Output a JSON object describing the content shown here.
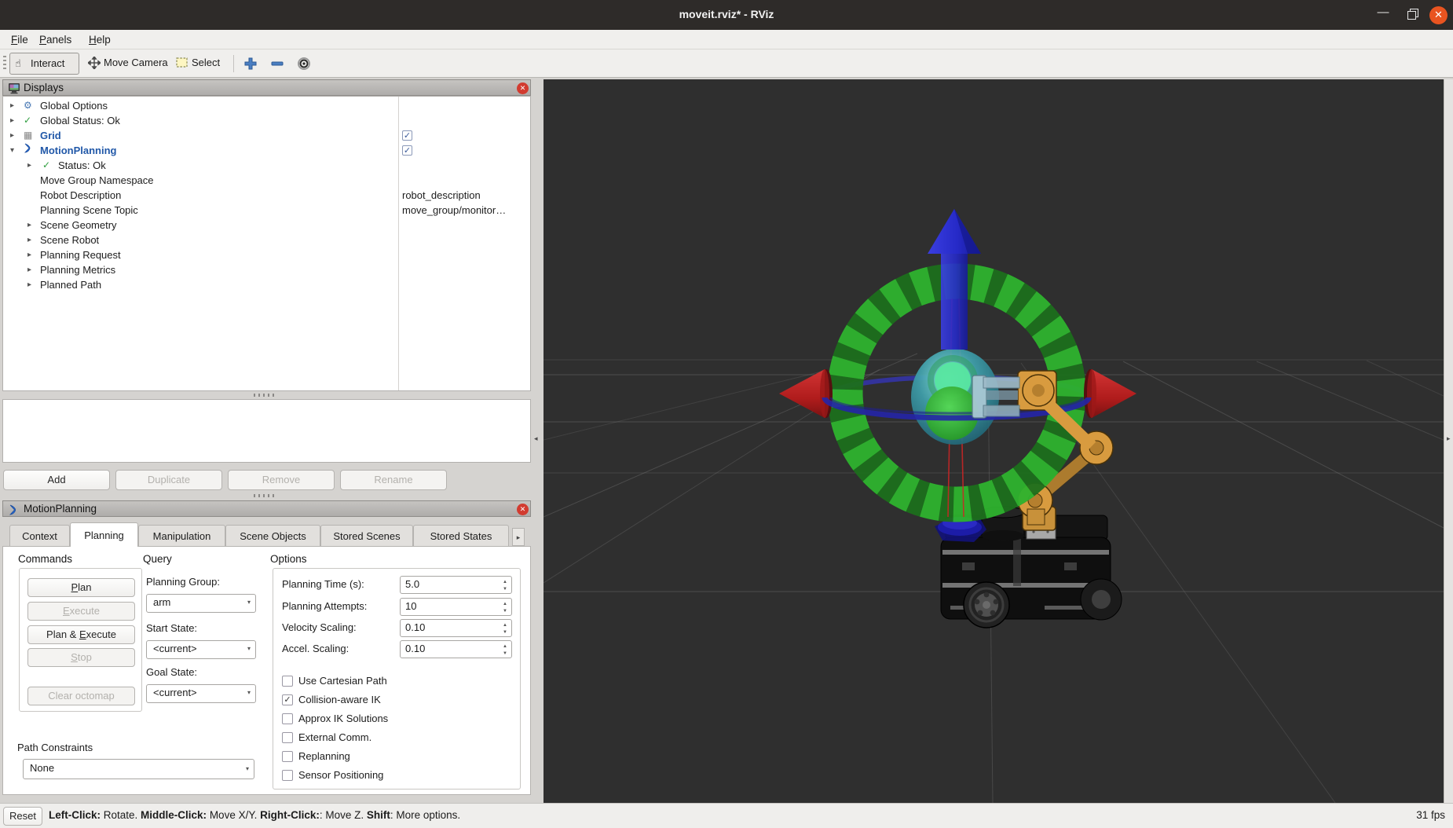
{
  "theme": {
    "close-orange": "#e95420",
    "close-red": "#d23b30",
    "viewport-bg": "#2f2f2f",
    "ring-green-bright": "#2eb32e",
    "ring-green-dark": "#1d6f1d",
    "axis-blue": "#2b2fd0",
    "axis-red": "#c22020",
    "sphere-teal": "#3a9aa8",
    "robot-orange": "#d89b3f",
    "tree-link-blue": "#2158a8"
  },
  "icons": {
    "collapsed": "▸",
    "expanded": "▾",
    "combo_arrow": "▾",
    "spin_up": "▲",
    "spin_down": "▼",
    "check": "✓",
    "gear": "⚙",
    "grid": "▦",
    "hand": "☝",
    "close_x": "✕",
    "minimize": "—",
    "tab_scroll": "▸",
    "handle_left": "◂",
    "handle_right": "▸"
  },
  "window": {
    "title": "moveit.rviz* - RViz"
  },
  "menu": {
    "file": {
      "pre": "",
      "u": "F",
      "post": "ile"
    },
    "panels": {
      "pre": "",
      "u": "P",
      "post": "anels"
    },
    "help": {
      "pre": "",
      "u": "H",
      "post": "elp"
    }
  },
  "toolbar": {
    "interact": "Interact",
    "move_camera": "Move Camera",
    "select": "Select"
  },
  "displays": {
    "title": "Displays",
    "tree": [
      {
        "label": "Global Options"
      },
      {
        "label": "Global Status: Ok"
      },
      {
        "label": "Grid"
      },
      {
        "label": "MotionPlanning"
      },
      {
        "label": "Status: Ok"
      },
      {
        "label": "Move Group Namespace"
      },
      {
        "label": "Robot Description",
        "value": "robot_description"
      },
      {
        "label": "Planning Scene Topic",
        "value": "move_group/monitor…"
      },
      {
        "label": "Scene Geometry"
      },
      {
        "label": "Scene Robot"
      },
      {
        "label": "Planning Request"
      },
      {
        "label": "Planning Metrics"
      },
      {
        "label": "Planned Path"
      }
    ]
  },
  "display_buttons": {
    "add": "Add",
    "duplicate": "Duplicate",
    "remove": "Remove",
    "rename": "Rename"
  },
  "motion_panel": {
    "title": "MotionPlanning",
    "tabs": [
      "Context",
      "Planning",
      "Manipulation",
      "Scene Objects",
      "Stored Scenes",
      "Stored States"
    ]
  },
  "planning_tab": {
    "commands_title": "Commands",
    "plan": {
      "pre": "",
      "u": "P",
      "post": "lan"
    },
    "execute": {
      "pre": "",
      "u": "E",
      "post": "xecute"
    },
    "plan_execute": {
      "pre": "Plan & ",
      "u": "E",
      "post": "xecute"
    },
    "stop": {
      "pre": "",
      "u": "S",
      "post": "top"
    },
    "clear_octomap": "Clear octomap",
    "query_title": "Query",
    "planning_group_label": "Planning Group:",
    "planning_group_value": "arm",
    "start_state_label": "Start State:",
    "start_state_value": "<current>",
    "goal_state_label": "Goal State:",
    "goal_state_value": "<current>",
    "options_title": "Options",
    "time_label": "Planning Time (s):",
    "time_value": "5.0",
    "attempts_label": "Planning Attempts:",
    "attempts_value": "10",
    "velocity_label": "Velocity Scaling:",
    "velocity_value": "0.10",
    "accel_label": "Accel. Scaling:",
    "accel_value": "0.10",
    "ck_cartesian": "Use Cartesian Path",
    "ck_collision": "Collision-aware IK",
    "ck_approx": "Approx IK Solutions",
    "ck_external": "External Comm.",
    "ck_replanning": "Replanning",
    "ck_sensor": "Sensor Positioning",
    "path_constraints_label": "Path Constraints",
    "path_constraints_value": "None"
  },
  "status_bar": {
    "reset": "Reset",
    "s1": "Left-Click:",
    "s2": " Rotate. ",
    "s3": "Middle-Click:",
    "s4": " Move X/Y. ",
    "s5": "Right-Click:",
    "s6": ": Move Z. ",
    "s7": "Shift",
    "s8": ": More options.",
    "fps": "31 fps"
  }
}
